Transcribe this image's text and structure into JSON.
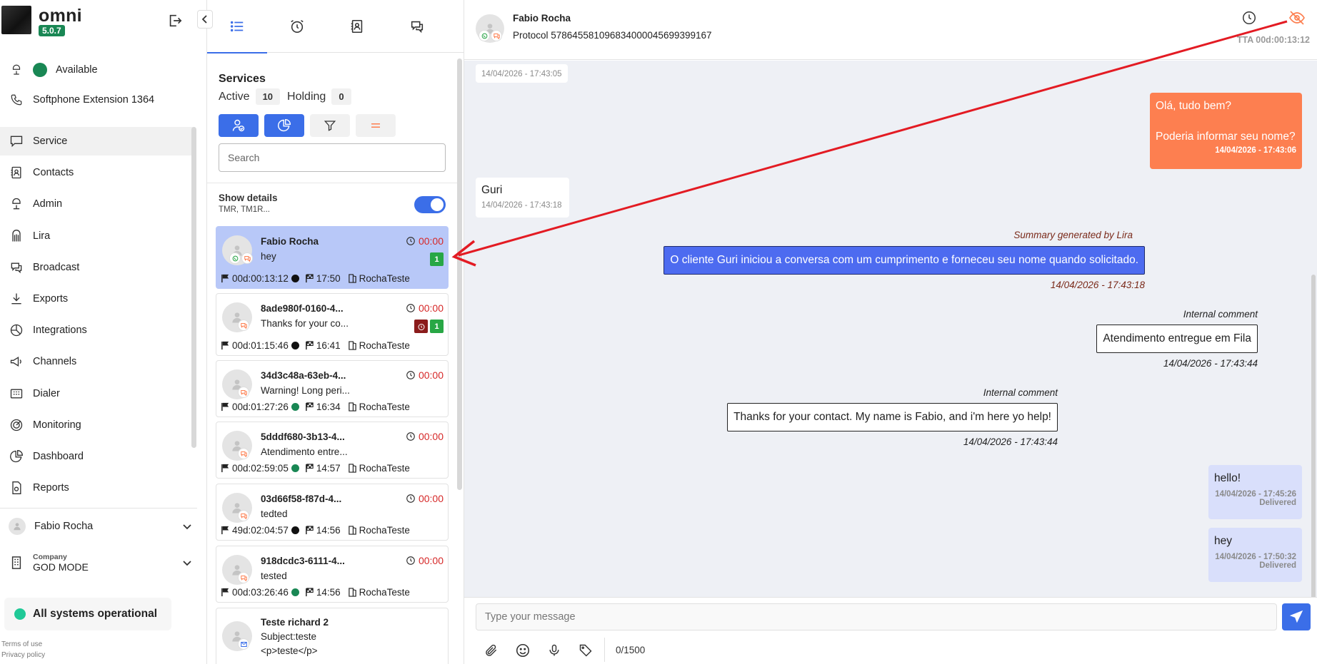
{
  "app": {
    "name": "omni",
    "version": "5.0.7"
  },
  "sidebar": {
    "status": "Available",
    "softphone": "Softphone Extension 1364",
    "items": [
      {
        "label": "Service",
        "icon": "chat-icon"
      },
      {
        "label": "Contacts",
        "icon": "contacts-icon"
      },
      {
        "label": "Admin",
        "icon": "admin-icon"
      },
      {
        "label": "Lira",
        "icon": "lira-icon"
      },
      {
        "label": "Broadcast",
        "icon": "broadcast-icon"
      },
      {
        "label": "Exports",
        "icon": "download-icon"
      },
      {
        "label": "Integrations",
        "icon": "integrations-icon"
      },
      {
        "label": "Channels",
        "icon": "megaphone-icon"
      },
      {
        "label": "Dialer",
        "icon": "dialer-icon"
      },
      {
        "label": "Monitoring",
        "icon": "monitoring-icon"
      },
      {
        "label": "Dashboard",
        "icon": "pie-chart-icon"
      },
      {
        "label": "Reports",
        "icon": "reports-icon"
      }
    ],
    "user": "Fabio Rocha",
    "company_label": "Company",
    "company": "GOD MODE",
    "system_status": "All systems operational",
    "terms": "Terms of use",
    "privacy": "Privacy policy"
  },
  "list": {
    "title": "Services",
    "active_label": "Active",
    "active_count": "10",
    "holding_label": "Holding",
    "holding_count": "0",
    "search_placeholder": "Search",
    "show_details": "Show details",
    "details_sub": "TMR, TM1R...",
    "cards": [
      {
        "name": "Fabio Rocha",
        "msg": "hey",
        "timer": "00:00",
        "dur": "00d:00:13:12",
        "dot": "#111111",
        "start": "17:50",
        "team": "RochaTeste",
        "unread": "1",
        "alarm": false,
        "whatsapp": true
      },
      {
        "name": "8ade980f-0160-4...",
        "msg": "Thanks for your co...",
        "timer": "00:00",
        "dur": "00d:01:15:46",
        "dot": "#111111",
        "start": "16:41",
        "team": "RochaTeste",
        "unread": "1",
        "alarm": true,
        "whatsapp": false
      },
      {
        "name": "34d3c48a-63eb-4...",
        "msg": "Warning! Long peri...",
        "timer": "00:00",
        "dur": "00d:01:27:26",
        "dot": "#198754",
        "start": "16:34",
        "team": "RochaTeste",
        "unread": "",
        "alarm": false,
        "whatsapp": false
      },
      {
        "name": "5dddf680-3b13-4...",
        "msg": "Atendimento entre...",
        "timer": "00:00",
        "dur": "00d:02:59:05",
        "dot": "#198754",
        "start": "14:57",
        "team": "RochaTeste",
        "unread": "",
        "alarm": false,
        "whatsapp": false
      },
      {
        "name": "03d66f58-f87d-4...",
        "msg": "tedted",
        "timer": "00:00",
        "dur": "49d:02:04:57",
        "dot": "#111111",
        "start": "14:56",
        "team": "RochaTeste",
        "unread": "",
        "alarm": false,
        "whatsapp": false
      },
      {
        "name": "918dcdc3-6111-4...",
        "msg": "tested",
        "timer": "00:00",
        "dur": "00d:03:26:46",
        "dot": "#198754",
        "start": "14:56",
        "team": "RochaTeste",
        "unread": "",
        "alarm": false,
        "whatsapp": false
      }
    ],
    "last_card": {
      "name": "Teste richard 2",
      "subject": "Subject:teste",
      "body": "<p>teste</p>"
    }
  },
  "chat": {
    "contact": "Fabio Rocha",
    "protocol": "Protocol 578645581096834000045699399167",
    "tta": "TTA 00d:00:13:12",
    "messages": {
      "first_ts": "14/04/2026 - 17:43:05",
      "m1_line1": "Olá, tudo bem?",
      "m1_line2": "Poderia informar seu nome?",
      "m1_ts": "14/04/2026 - 17:43:06",
      "m2_text": "Guri",
      "m2_ts": "14/04/2026 - 17:43:18",
      "lira_label": "Summary generated by Lira",
      "lira_text": "O cliente Guri iniciou a conversa com um cumprimento e forneceu seu nome quando solicitado.",
      "lira_ts": "14/04/2026 - 17:43:18",
      "ic1_label": "Internal comment",
      "ic1_text": "Atendimento entregue em Fila",
      "ic1_ts": "14/04/2026 - 17:43:44",
      "ic2_label": "Internal comment",
      "ic2_text": "Thanks for your contact. My name is Fabio, and i'm here yo help!",
      "ic2_ts": "14/04/2026 - 17:43:44",
      "out1_text": "hello!",
      "out1_ts": "14/04/2026 - 17:45:26",
      "out1_status": "Delivered",
      "out2_text": "hey",
      "out2_ts": "14/04/2026 - 17:50:32",
      "out2_status": "Delivered"
    },
    "composer_placeholder": "Type your message",
    "char_count": "0/1500"
  },
  "colors": {
    "accent": "#3b6ee8",
    "orange": "#fd7f50",
    "lira": "#4d6bf0",
    "annotation": "#e31b23"
  }
}
